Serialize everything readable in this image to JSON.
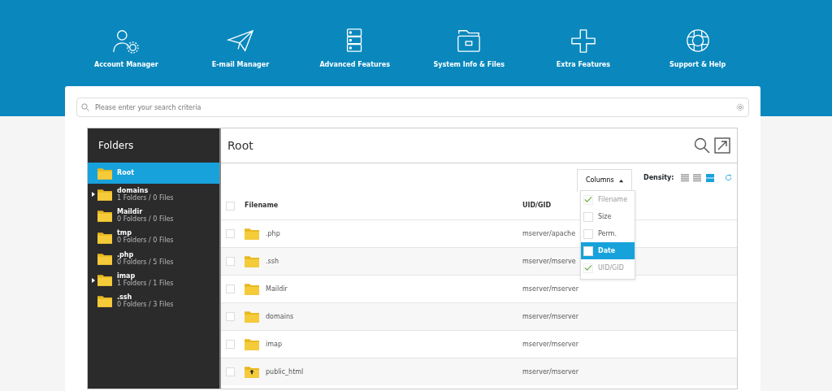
{
  "nav": [
    {
      "label": "Account Manager"
    },
    {
      "label": "E-mail Manager"
    },
    {
      "label": "Advanced Features"
    },
    {
      "label": "System Info & Files"
    },
    {
      "label": "Extra Features"
    },
    {
      "label": "Support & Help"
    }
  ],
  "search": {
    "placeholder": "Please enter your search criteria"
  },
  "sidebar": {
    "title": "Folders",
    "items": [
      {
        "name": "Root",
        "selected": true,
        "expandable": false
      },
      {
        "name": "domains",
        "info": "1 Folders / 0 Files",
        "selected": false,
        "expandable": true
      },
      {
        "name": "Maildir",
        "info": "0 Folders / 0 Files",
        "selected": false,
        "expandable": false
      },
      {
        "name": "tmp",
        "info": "0 Folders / 0 Files",
        "selected": false,
        "expandable": false
      },
      {
        "name": ".php",
        "info": "0 Folders / 5 Files",
        "selected": false,
        "expandable": false
      },
      {
        "name": "imap",
        "info": "1 Folders / 1 Files",
        "selected": false,
        "expandable": true
      },
      {
        "name": ".ssh",
        "info": "0 Folders / 3 Files",
        "selected": false,
        "expandable": false
      }
    ]
  },
  "panel": {
    "title": "Root"
  },
  "columns_menu": {
    "label": "Columns",
    "expanded": true,
    "items": [
      {
        "label": "Filename",
        "checked": true,
        "selected": false
      },
      {
        "label": "Size",
        "checked": false,
        "selected": false
      },
      {
        "label": "Perm.",
        "checked": false,
        "selected": false
      },
      {
        "label": "Date",
        "checked": false,
        "selected": true
      },
      {
        "label": "UID/GID",
        "checked": true,
        "selected": false
      }
    ]
  },
  "density": {
    "label": "Density:",
    "options": [
      {
        "selected": false
      },
      {
        "selected": false
      },
      {
        "selected": true
      }
    ]
  },
  "table": {
    "select_all_checked": false,
    "columns": [
      "Filename",
      "UID/GID"
    ],
    "rows": [
      {
        "name": ".php",
        "owner": "mserver/apache",
        "kind": "folder",
        "checked": false
      },
      {
        "name": ".ssh",
        "owner": "mserver/mserve",
        "kind": "folder",
        "checked": false
      },
      {
        "name": "Maildir",
        "owner": "mserver/mserver",
        "kind": "folder",
        "checked": false
      },
      {
        "name": "domains",
        "owner": "mserver/mserver",
        "kind": "folder",
        "checked": false
      },
      {
        "name": "imap",
        "owner": "mserver/mserver",
        "kind": "folder",
        "checked": false
      },
      {
        "name": "public_html",
        "owner": "mserver/mserver",
        "kind": "web",
        "checked": false
      }
    ]
  }
}
